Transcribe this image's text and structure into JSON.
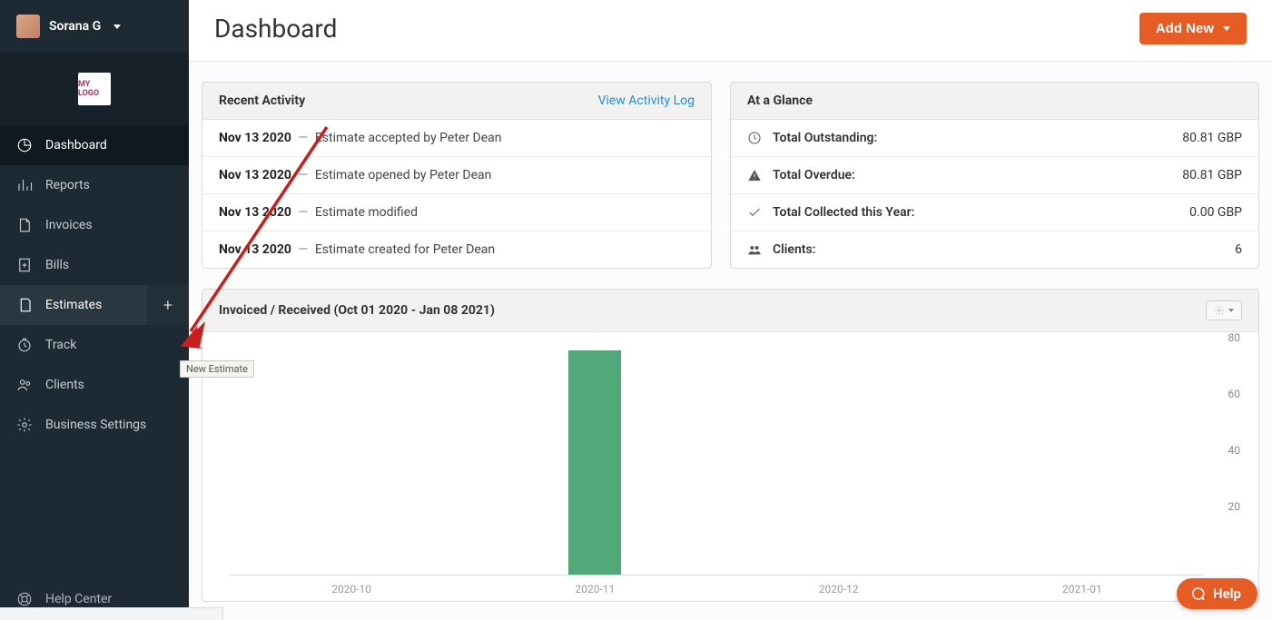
{
  "user": {
    "name": "Sorana G"
  },
  "sidebar": {
    "items": [
      {
        "label": "Dashboard"
      },
      {
        "label": "Reports"
      },
      {
        "label": "Invoices"
      },
      {
        "label": "Bills"
      },
      {
        "label": "Estimates"
      },
      {
        "label": "Track"
      },
      {
        "label": "Clients"
      },
      {
        "label": "Business Settings"
      }
    ],
    "footer": "Help Center",
    "tooltip": "New Estimate"
  },
  "header": {
    "title": "Dashboard",
    "addNew": "Add New"
  },
  "recentActivity": {
    "title": "Recent Activity",
    "link": "View Activity Log",
    "rows": [
      {
        "date": "Nov 13 2020",
        "text": "Estimate accepted by Peter Dean"
      },
      {
        "date": "Nov 13 2020",
        "text": "Estimate opened by Peter Dean"
      },
      {
        "date": "Nov 13 2020",
        "text": "Estimate modified"
      },
      {
        "date": "Nov 13 2020",
        "text": "Estimate created for Peter Dean"
      }
    ]
  },
  "glance": {
    "title": "At a Glance",
    "rows": [
      {
        "label": "Total Outstanding:",
        "value": "80.81 GBP"
      },
      {
        "label": "Total Overdue:",
        "value": "80.81 GBP"
      },
      {
        "label": "Total Collected this Year:",
        "value": "0.00 GBP"
      },
      {
        "label": "Clients:",
        "value": "6"
      }
    ]
  },
  "chart": {
    "title": "Invoiced / Received (Oct 01 2020 - Jan 08 2021)"
  },
  "chart_data": {
    "type": "bar",
    "categories": [
      "2020-10",
      "2020-11",
      "2020-12",
      "2021-01"
    ],
    "values": [
      0,
      80.81,
      0,
      0
    ],
    "title": "Invoiced / Received (Oct 01 2020 - Jan 08 2021)",
    "xlabel": "",
    "ylabel": "",
    "ylim": [
      0,
      80
    ],
    "yticks": [
      20,
      40,
      60,
      80
    ]
  },
  "help": {
    "label": "Help"
  },
  "statusbar": ""
}
